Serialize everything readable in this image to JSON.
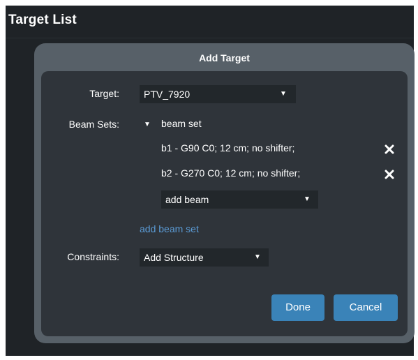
{
  "page": {
    "title": "Target List"
  },
  "dialog": {
    "title": "Add Target",
    "target": {
      "label": "Target:",
      "value": "PTV_7920"
    },
    "beam_sets": {
      "label": "Beam Sets:",
      "set_name": "beam set",
      "beams": [
        {
          "label": "b1 - G90 C0; 12 cm; no shifter;"
        },
        {
          "label": "b2 - G270 C0; 12 cm; no shifter;"
        }
      ],
      "add_beam_placeholder": "add beam",
      "add_beam_set_link": "add beam set"
    },
    "constraints": {
      "label": "Constraints:",
      "value": "Add Structure"
    },
    "buttons": {
      "done": "Done",
      "cancel": "Cancel"
    }
  },
  "colors": {
    "page_bg": "#1f2327",
    "dialog_frame": "#576068",
    "dialog_body": "#2f343a",
    "select_bg": "#22272b",
    "link": "#5b9bd5",
    "primary_button": "#3a83b8"
  },
  "icons": {
    "dropdown": "caret-down-icon",
    "expand": "triangle-down-icon",
    "remove": "close-x-icon"
  }
}
